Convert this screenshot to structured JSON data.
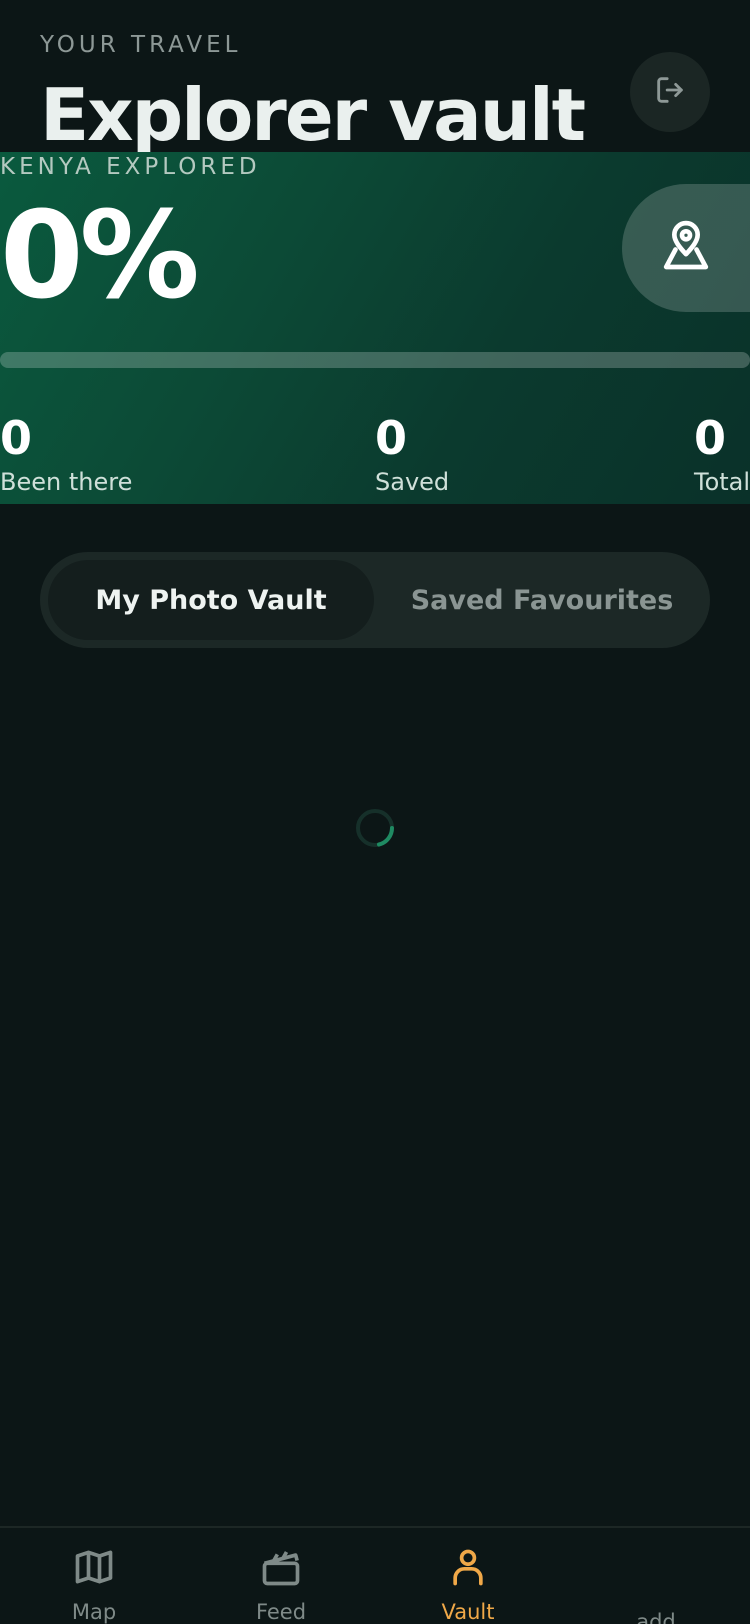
{
  "header": {
    "eyebrow": "YOUR TRAVEL",
    "title": "Explorer vault",
    "logout_icon": "logout-icon"
  },
  "explore_card": {
    "eyebrow": "KENYA EXPLORED",
    "percent_text": "0%",
    "progress_fraction": 0,
    "map_icon": "map-pin-icon",
    "stats": [
      {
        "value": "0",
        "label": "Been there"
      },
      {
        "value": "0",
        "label": "Saved"
      },
      {
        "value": "0",
        "label": "Total"
      }
    ]
  },
  "tabs": {
    "active": "My Photo Vault",
    "inactive": "Saved Favourites"
  },
  "nav": {
    "items": [
      {
        "label": "Map",
        "icon": "map-icon"
      },
      {
        "label": "Feed",
        "icon": "clapperboard-icon"
      },
      {
        "label": "Vault",
        "icon": "user-icon"
      },
      {
        "label": "add",
        "icon": ""
      }
    ]
  },
  "colors": {
    "background": "#0c1616",
    "accent": "#f0a848",
    "card": "#0a5a3e",
    "spinner": "#1f8a62"
  }
}
